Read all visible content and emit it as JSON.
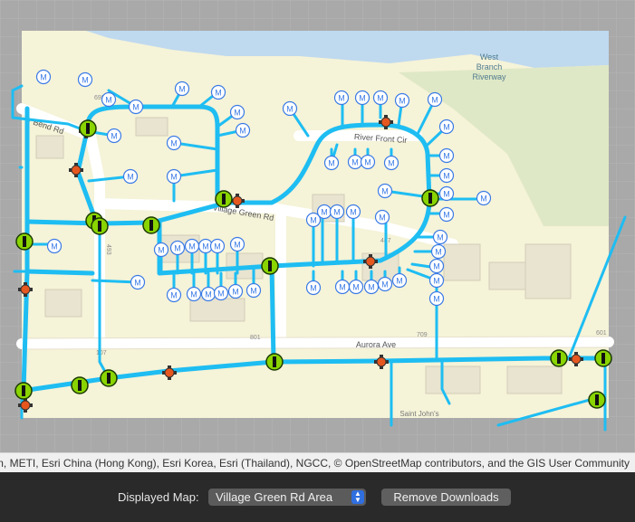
{
  "map": {
    "labels": {
      "river": [
        "West",
        "Branch",
        "Riverway"
      ],
      "front_cir": "River Front Cir",
      "village_green": "Village Green Rd",
      "aurora": "Aurora Ave",
      "bend": "r Bend Rd",
      "saint_johns": "Saint John's",
      "num_698": "698",
      "num_493": "493",
      "num_487": "487",
      "num_801": "801",
      "num_709": "709",
      "num_601": "601",
      "num_107": "107"
    },
    "meter_symbol": "M",
    "colors": {
      "canvas": "#a9a9a9",
      "land": "#f5f3d8",
      "water": "#bfd9ef",
      "pipe": "#1ebdf2",
      "meter_ring": "#3b7be6",
      "valve_fill": "#8ad400",
      "hydrant_fill": "#e5571f"
    }
  },
  "attribution": "n, METI, Esri China (Hong Kong), Esri Korea, Esri (Thailand), NGCC, © OpenStreetMap contributors, and the GIS User Community",
  "toolbar": {
    "displayed_map_label": "Displayed Map:",
    "displayed_map_value": "Village Green Rd Area",
    "remove_button": "Remove Downloads"
  }
}
